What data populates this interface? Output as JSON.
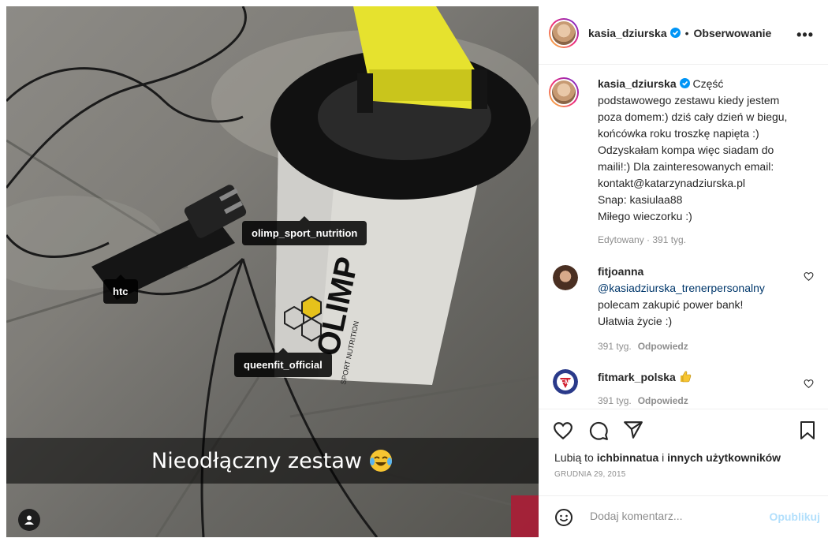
{
  "photo": {
    "tags": [
      "olimp_sport_nutrition",
      "htc",
      "queenfit_official"
    ],
    "caption_overlay": "Nieodłączny zestaw",
    "bottle_brand": "OLIMP",
    "bottle_subtext": "SPORT NUTRITION"
  },
  "header": {
    "username": "kasia_dziurska",
    "separator": "•",
    "follow_label": "Obserwowanie",
    "more_label": "•••"
  },
  "post_caption": {
    "username": "kasia_dziurska",
    "lines": [
      "Część",
      "podstawowego zestawu kiedy jestem",
      "poza domem:) dziś cały dzień w biegu,",
      "końcówka roku troszkę napięta :)",
      "Odzyskałam kompa więc siadam do",
      "maili!:) Dla zainteresowanych email:",
      "kontakt@katarzynadziurska.pl",
      "Snap: kasiulaa88",
      "Miłego wieczorku :)"
    ],
    "edited": "Edytowany · 391 tyg."
  },
  "comments": [
    {
      "username": "fitjoanna",
      "mention": "@kasiadziurska_trenerpersonalny",
      "text_lines": [
        "polecam zakupić power bank!",
        "Ułatwia życie :)"
      ],
      "age": "391 tyg.",
      "reply_label": "Odpowiedz"
    },
    {
      "username": "fitmark_polska",
      "age": "391 tyg.",
      "reply_label": "Odpowiedz"
    }
  ],
  "likes": {
    "prefix": "Lubią to ",
    "user": "ichbinnatua",
    "middle": " i ",
    "others": "innych użytkowników"
  },
  "date": "GRUDNIA 29, 2015",
  "comment_box": {
    "placeholder": "Dodaj komentarz...",
    "publish_label": "Opublikuj"
  },
  "colors": {
    "verified": "#0095f6",
    "link": "#00376b",
    "publish_disabled": "#b2dffc"
  }
}
